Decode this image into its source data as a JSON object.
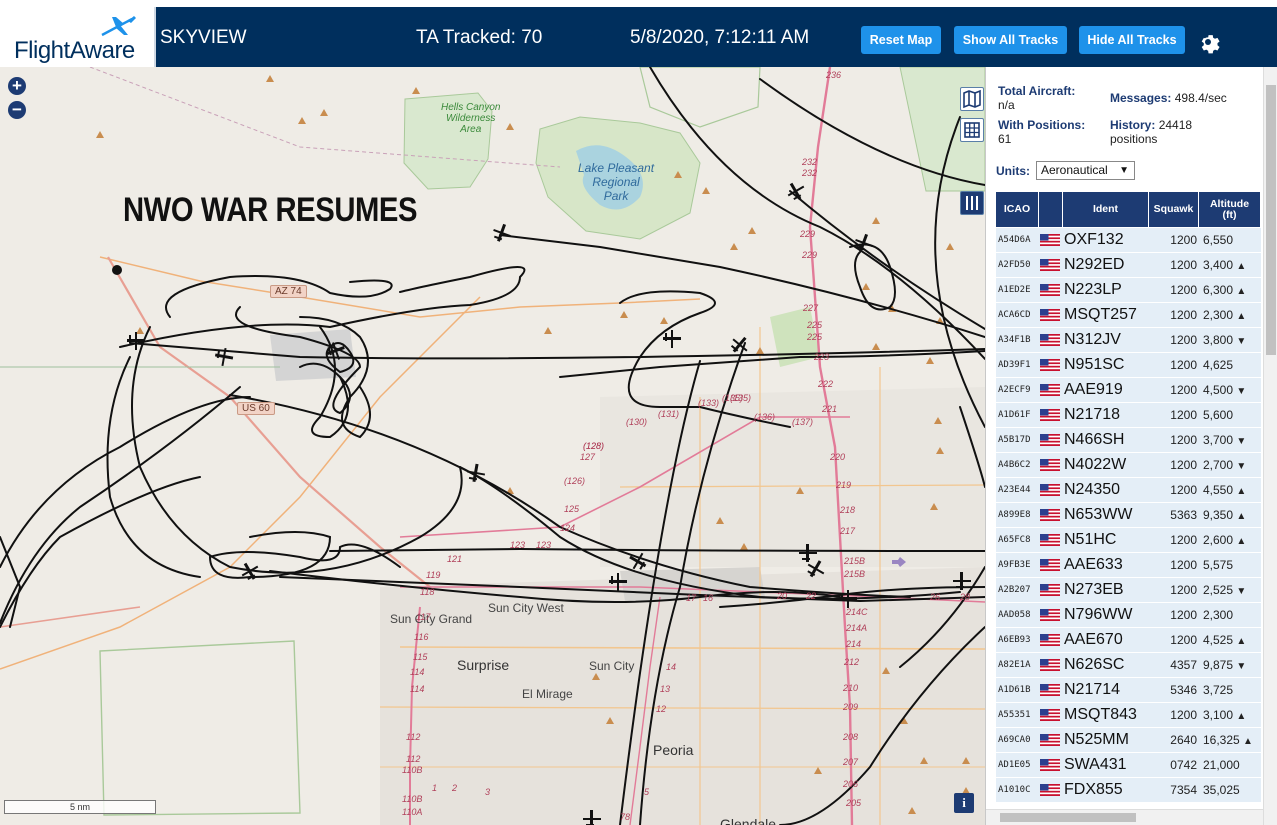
{
  "header": {
    "logo_text": "FlightAware",
    "app_title": "SKYVIEW",
    "tracked": "TA Tracked: 70",
    "datetime": "5/8/2020, 7:12:11 AM",
    "btn_reset": "Reset Map",
    "btn_show_tracks": "Show All Tracks",
    "btn_hide_tracks": "Hide All Tracks",
    "settings_icon": "gear-icon"
  },
  "map": {
    "overlay_text": "NWO WAR RESUMES",
    "zoom_in": "+",
    "zoom_out": "−",
    "scale": "5 nm",
    "info": "i",
    "controls": [
      "map-icon",
      "grid-icon",
      "columns-icon"
    ],
    "labels": {
      "hells_canyon": "Hells Canyon\nWilderness\nArea",
      "lake_pleasant": "Lake Pleasant\nRegional\nPark",
      "sun_city_grand": "Sun City Grand",
      "sun_city_west": "Sun City West",
      "surprise": "Surprise",
      "sun_city": "Sun City",
      "el_mirage": "El Mirage",
      "peoria": "Peoria",
      "glendale": "Glendale",
      "az74": "AZ 74",
      "us60": "US 60"
    },
    "route_numbers": [
      "236",
      "232",
      "232",
      "229",
      "229",
      "227",
      "225",
      "225",
      "223",
      "222",
      "221",
      "220",
      "219",
      "218",
      "217",
      "215B",
      "215B",
      "214C",
      "214A",
      "214",
      "212",
      "210",
      "209",
      "208",
      "207",
      "206",
      "205",
      "(135)",
      "(130)",
      "(131)",
      "(136)",
      "(137)",
      "(128)",
      "(128)",
      "127",
      "(126)",
      "125",
      "124",
      "123",
      "123",
      "121",
      "119",
      "118",
      "117",
      "116",
      "115",
      "114",
      "114",
      "112",
      "112",
      "110B",
      "110B",
      "110A",
      "(133)",
      "(135)",
      "17",
      "16",
      "20",
      "22",
      "26",
      "28",
      "1",
      "2",
      "3",
      "78",
      "14",
      "13",
      "12",
      "5"
    ]
  },
  "stats": {
    "total_aircraft_label": "Total Aircraft:",
    "total_aircraft_value": "n/a",
    "with_positions_label": "With Positions:",
    "with_positions_value": "61",
    "messages_label": "Messages:",
    "messages_value": "498.4/sec",
    "history_label": "History:",
    "history_value": "24418",
    "history_unit": "positions",
    "units_label": "Units:",
    "units_value": "Aeronautical"
  },
  "table": {
    "headers": {
      "icao": "ICAO",
      "flag": "",
      "ident": "Ident",
      "squawk": "Squawk",
      "altitude": "Altitude\n(ft)"
    },
    "rows": [
      {
        "icao": "A54D6A",
        "ident": "OXF132",
        "squawk": "1200",
        "altitude": "6,550",
        "trend": ""
      },
      {
        "icao": "A2FD50",
        "ident": "N292ED",
        "squawk": "1200",
        "altitude": "3,400",
        "trend": "▲"
      },
      {
        "icao": "A1ED2E",
        "ident": "N223LP",
        "squawk": "1200",
        "altitude": "6,300",
        "trend": "▲"
      },
      {
        "icao": "ACA6CD",
        "ident": "MSQT257",
        "squawk": "1200",
        "altitude": "2,300",
        "trend": "▲"
      },
      {
        "icao": "A34F1B",
        "ident": "N312JV",
        "squawk": "1200",
        "altitude": "3,800",
        "trend": "▼"
      },
      {
        "icao": "AD39F1",
        "ident": "N951SC",
        "squawk": "1200",
        "altitude": "4,625",
        "trend": ""
      },
      {
        "icao": "A2ECF9",
        "ident": "AAE919",
        "squawk": "1200",
        "altitude": "4,500",
        "trend": "▼"
      },
      {
        "icao": "A1D61F",
        "ident": "N21718",
        "squawk": "1200",
        "altitude": "5,600",
        "trend": ""
      },
      {
        "icao": "A5B17D",
        "ident": "N466SH",
        "squawk": "1200",
        "altitude": "3,700",
        "trend": "▼"
      },
      {
        "icao": "A4B6C2",
        "ident": "N4022W",
        "squawk": "1200",
        "altitude": "2,700",
        "trend": "▼"
      },
      {
        "icao": "A23E44",
        "ident": "N24350",
        "squawk": "1200",
        "altitude": "4,550",
        "trend": "▲"
      },
      {
        "icao": "A899E8",
        "ident": "N653WW",
        "squawk": "5363",
        "altitude": "9,350",
        "trend": "▲"
      },
      {
        "icao": "A65FC8",
        "ident": "N51HC",
        "squawk": "1200",
        "altitude": "2,600",
        "trend": "▲"
      },
      {
        "icao": "A9FB3E",
        "ident": "AAE633",
        "squawk": "1200",
        "altitude": "5,575",
        "trend": ""
      },
      {
        "icao": "A2B207",
        "ident": "N273EB",
        "squawk": "1200",
        "altitude": "2,525",
        "trend": "▼"
      },
      {
        "icao": "AAD058",
        "ident": "N796WW",
        "squawk": "1200",
        "altitude": "2,300",
        "trend": ""
      },
      {
        "icao": "A6EB93",
        "ident": "AAE670",
        "squawk": "1200",
        "altitude": "4,525",
        "trend": "▲"
      },
      {
        "icao": "A82E1A",
        "ident": "N626SC",
        "squawk": "4357",
        "altitude": "9,875",
        "trend": "▼"
      },
      {
        "icao": "A1D61B",
        "ident": "N21714",
        "squawk": "5346",
        "altitude": "3,725",
        "trend": ""
      },
      {
        "icao": "A55351",
        "ident": "MSQT843",
        "squawk": "1200",
        "altitude": "3,100",
        "trend": "▲"
      },
      {
        "icao": "A69CA0",
        "ident": "N525MM",
        "squawk": "2640",
        "altitude": "16,325",
        "trend": "▲"
      },
      {
        "icao": "AD1E05",
        "ident": "SWA431",
        "squawk": "0742",
        "altitude": "21,000",
        "trend": ""
      },
      {
        "icao": "A1010C",
        "ident": "FDX855",
        "squawk": "7354",
        "altitude": "35,025",
        "trend": ""
      }
    ]
  },
  "colors": {
    "header_bg": "#002f5d",
    "button_bg": "#1e92ea",
    "table_header_bg": "#1d3b73",
    "row_bg": "#e4eef7",
    "map_bg": "#efece6",
    "track": "#111111"
  }
}
